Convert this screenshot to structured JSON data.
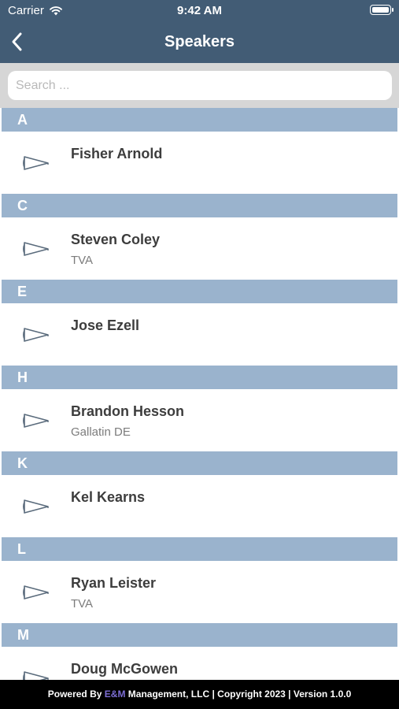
{
  "status_bar": {
    "carrier": "Carrier",
    "time": "9:42 AM"
  },
  "nav": {
    "title": "Speakers"
  },
  "search": {
    "placeholder": "Search ..."
  },
  "sections": [
    {
      "letter": "A",
      "speakers": [
        {
          "name": "Fisher Arnold",
          "org": ""
        }
      ]
    },
    {
      "letter": "C",
      "speakers": [
        {
          "name": "Steven Coley",
          "org": "TVA"
        }
      ]
    },
    {
      "letter": "E",
      "speakers": [
        {
          "name": "Jose Ezell",
          "org": ""
        }
      ]
    },
    {
      "letter": "H",
      "speakers": [
        {
          "name": "Brandon Hesson",
          "org": "Gallatin DE"
        }
      ]
    },
    {
      "letter": "K",
      "speakers": [
        {
          "name": "Kel Kearns",
          "org": ""
        }
      ]
    },
    {
      "letter": "L",
      "speakers": [
        {
          "name": "Ryan Leister",
          "org": "TVA"
        }
      ]
    },
    {
      "letter": "M",
      "speakers": [
        {
          "name": "Doug McGowen",
          "org": ""
        }
      ]
    }
  ],
  "footer": {
    "prefix": "Powered By ",
    "brand": "E&M",
    "suffix": " Management, LLC | Copyright 2023 | Version 1.0.0"
  },
  "colors": {
    "header": "#425c75",
    "section": "#9ab3cd",
    "footer": "#000000",
    "brand": "#7e6fd6"
  },
  "icons": {
    "speaker_row": "megaphone-icon",
    "back": "chevron-left-icon",
    "wifi": "wifi-icon",
    "battery": "battery-icon"
  }
}
